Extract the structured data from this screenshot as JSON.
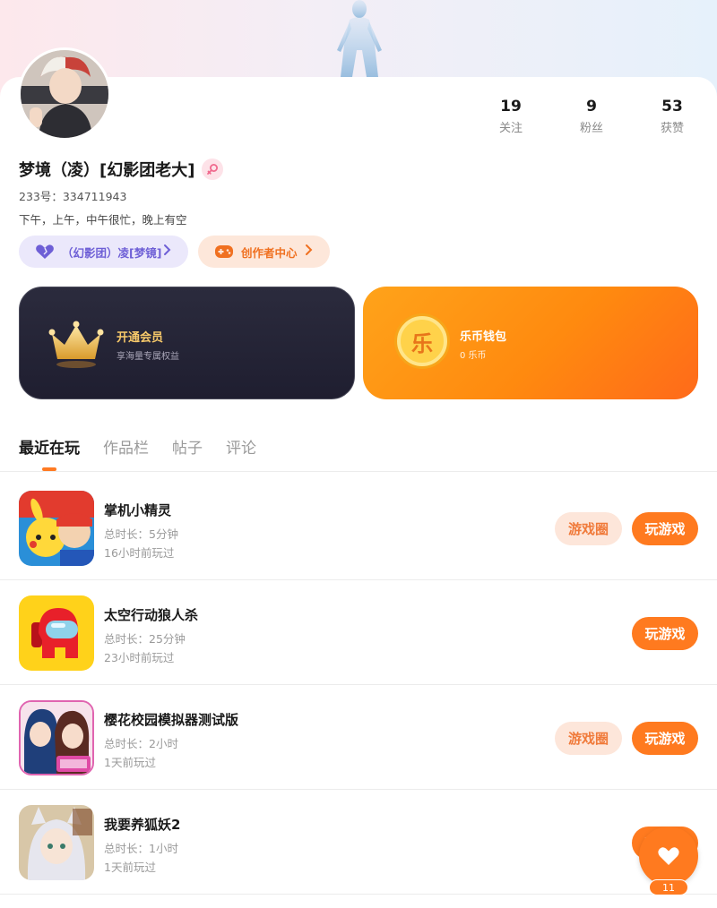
{
  "profile": {
    "username": "梦境（凌）[幻影团老大]",
    "uid": "233号：334711943",
    "bio": "下午，上午，中午很忙，晚上有空"
  },
  "stats": [
    {
      "value": "19",
      "label": "关注"
    },
    {
      "value": "9",
      "label": "粉丝"
    },
    {
      "value": "53",
      "label": "获赞"
    }
  ],
  "pills": {
    "guild": "（幻影团）凌[梦镜]",
    "creator": "创作者中心"
  },
  "cards": {
    "vip_title": "开通会员",
    "vip_sub": "享海量专属权益",
    "wallet_title": "乐币钱包",
    "wallet_sub": "0 乐币",
    "wallet_coin_char": "乐"
  },
  "tabs": [
    {
      "label": "最近在玩",
      "active": true
    },
    {
      "label": "作品栏",
      "active": false
    },
    {
      "label": "帖子",
      "active": false
    },
    {
      "label": "评论",
      "active": false
    }
  ],
  "games": [
    {
      "name": "掌机小精灵",
      "duration": "总时长：5分钟",
      "last_played": "16小时前玩过",
      "has_circle": true
    },
    {
      "name": "太空行动狼人杀",
      "duration": "总时长：25分钟",
      "last_played": "23小时前玩过",
      "has_circle": false
    },
    {
      "name": "樱花校园模拟器测试版",
      "duration": "总时长：2小时",
      "last_played": "1天前玩过",
      "has_circle": true
    },
    {
      "name": "我要养狐妖2",
      "duration": "总时长：1小时",
      "last_played": "1天前玩过",
      "has_circle": false
    }
  ],
  "buttons": {
    "circle": "游戏圈",
    "play": "玩游戏"
  },
  "fab": {
    "count": "11",
    "icon": "heart-icon"
  },
  "colors": {
    "accent": "#ff7a1f",
    "vip_gold": "#f7c96a",
    "guild_purple": "#6e5fd6"
  }
}
